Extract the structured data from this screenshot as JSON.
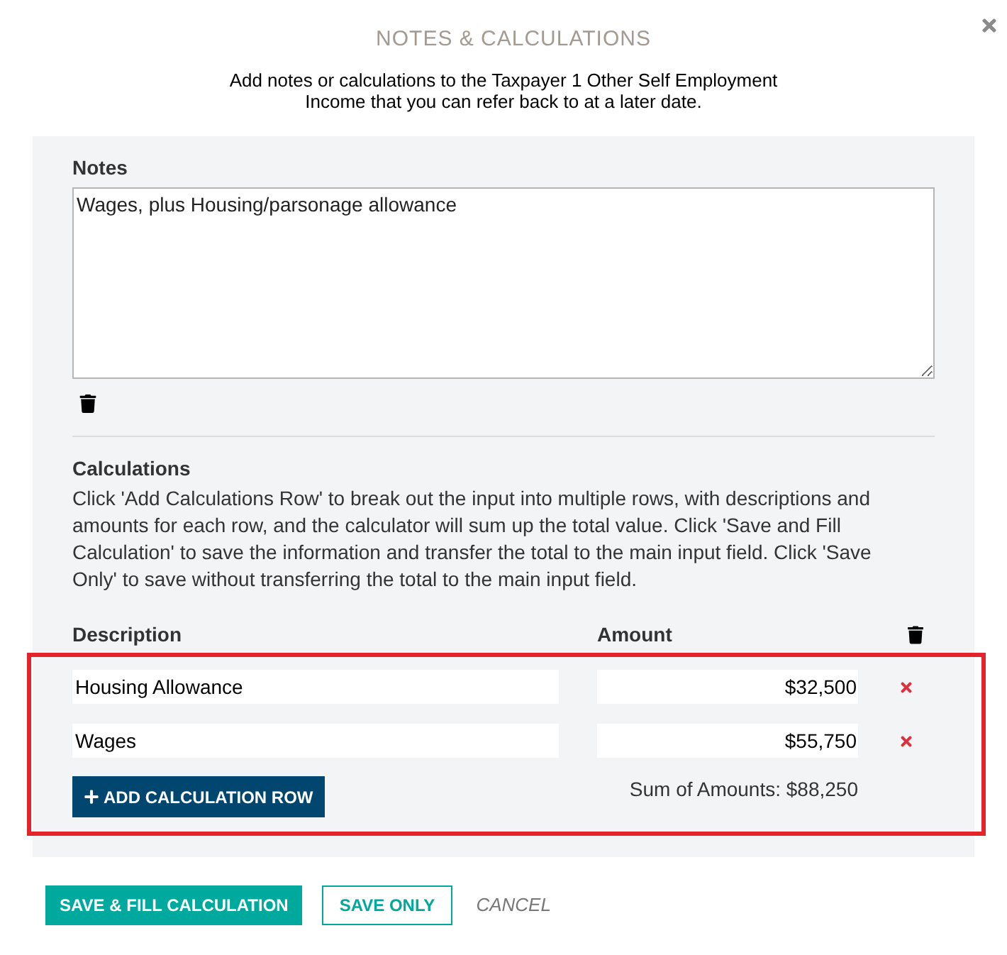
{
  "dialog": {
    "title": "NOTES & CALCULATIONS",
    "intro": "Add notes or calculations to the Taxpayer 1 Other Self Employment Income that you can refer back to at a later date."
  },
  "notes": {
    "label": "Notes",
    "value": "Wages, plus Housing/parsonage allowance"
  },
  "calculations": {
    "label": "Calculations",
    "help": "Click 'Add Calculations Row' to break out the input into multiple rows, with descriptions and amounts for each row, and the calculator will sum up the total value. Click 'Save and Fill Calculation' to save the information and transfer the total to the main input field. Click 'Save Only' to save without transferring the total to the main input field.",
    "columns": [
      "Description",
      "Amount"
    ],
    "rows": [
      {
        "description": "Housing Allowance",
        "amount": "$32,500"
      },
      {
        "description": "Wages",
        "amount": "$55,750"
      }
    ],
    "add_button": "ADD CALCULATION ROW",
    "sum": "Sum of Amounts: $88,250",
    "highlighted": true
  },
  "actions": [
    {
      "kind": "primary",
      "label": "SAVE & FILL CALCULATION"
    },
    {
      "kind": "outline",
      "label": "SAVE ONLY"
    },
    {
      "kind": "link",
      "label": "CANCEL"
    }
  ]
}
